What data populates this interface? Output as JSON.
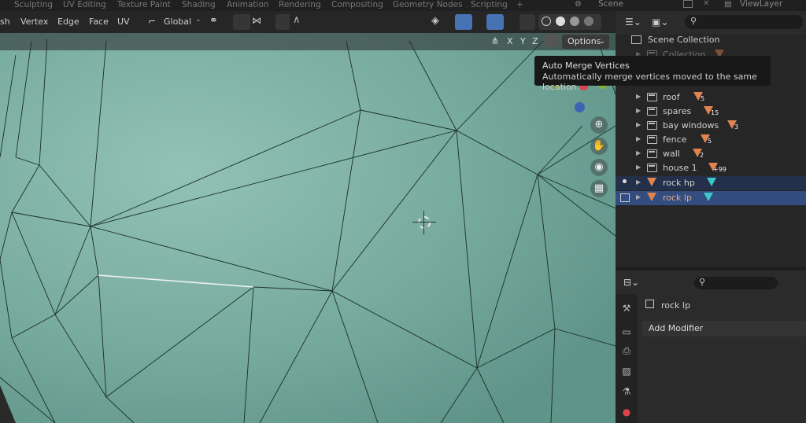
{
  "workspace_tabs": [
    "Sculpting",
    "UV Editing",
    "Texture Paint",
    "Shading",
    "Animation",
    "Rendering",
    "Compositing",
    "Geometry Nodes",
    "Scripting",
    "+"
  ],
  "scene_label": "Scene",
  "view_layer_label": "ViewLayer",
  "viewport_menu": [
    "sh",
    "Vertex",
    "Edge",
    "Face",
    "UV"
  ],
  "transform_orientation": "Global",
  "axes": [
    "X",
    "Y",
    "Z"
  ],
  "options_label": "Options",
  "tooltip": {
    "title": "Auto Merge Vertices",
    "description": "Automatically merge vertices moved to the same location."
  },
  "outliner": {
    "scene_collection": "Scene Collection",
    "partial_row": "Collection",
    "collections": [
      {
        "name": "roof",
        "count": "5"
      },
      {
        "name": "spares",
        "count": "15"
      },
      {
        "name": "bay windows",
        "count": "3"
      },
      {
        "name": "fence",
        "count": "5"
      },
      {
        "name": "wall",
        "count": "2"
      },
      {
        "name": "house 1",
        "count": "+99"
      }
    ],
    "objects": [
      {
        "name": "rock hp"
      },
      {
        "name": "rock lp"
      }
    ]
  },
  "properties": {
    "object_name": "rock lp",
    "add_modifier_label": "Add Modifier"
  },
  "colors": {
    "viewport_mesh": "#78ab9e",
    "active_row": "#334d80",
    "accent_orange": "#e0834f",
    "mesh_cyan": "#3fc7c7"
  }
}
